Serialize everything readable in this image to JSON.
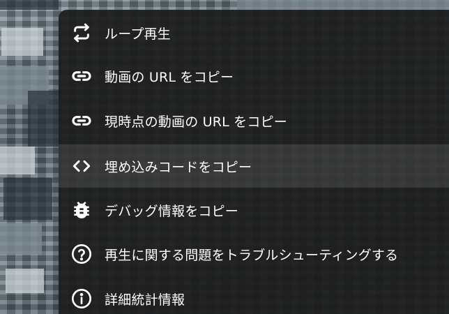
{
  "colors": {
    "menu_background": "#1c1c1c",
    "hover_background": "#333333",
    "text": "#ffffff"
  },
  "menu": {
    "items": [
      {
        "label": "ループ再生",
        "icon": "loop-icon"
      },
      {
        "label": "動画の URL をコピー",
        "icon": "link-icon"
      },
      {
        "label": "現時点の動画の URL をコピー",
        "icon": "link-icon"
      },
      {
        "label": "埋め込みコードをコピー",
        "icon": "embed-code-icon",
        "highlighted": true
      },
      {
        "label": "デバッグ情報をコピー",
        "icon": "bug-icon"
      },
      {
        "label": "再生に関する問題をトラブルシューティングする",
        "icon": "help-circle-icon"
      },
      {
        "label": "詳細統計情報",
        "icon": "info-circle-icon"
      }
    ]
  }
}
